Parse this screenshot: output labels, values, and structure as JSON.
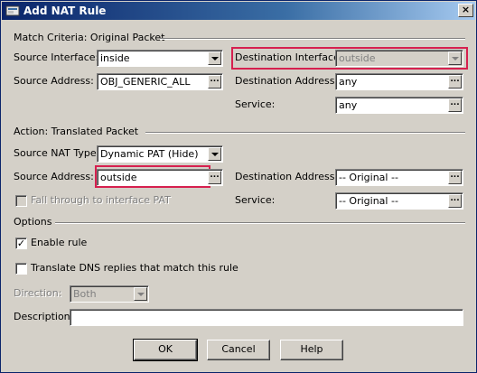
{
  "window": {
    "title": "Add NAT Rule",
    "close_label": "×"
  },
  "match_criteria": {
    "heading": "Match Criteria: Original Packet",
    "source_interface": {
      "label": "Source Interface:",
      "value": "inside"
    },
    "source_address": {
      "label": "Source Address:",
      "value": "OBJ_GENERIC_ALL"
    },
    "destination_interface": {
      "label": "Destination Interface:",
      "value": "outside",
      "disabled": true
    },
    "destination_address": {
      "label": "Destination Address:",
      "value": "any"
    },
    "service": {
      "label": "Service:",
      "value": "any"
    }
  },
  "action": {
    "heading": "Action: Translated Packet",
    "source_nat_type": {
      "label": "Source NAT Type:",
      "value": "Dynamic PAT (Hide)"
    },
    "source_address": {
      "label": "Source Address:",
      "value": "outside"
    },
    "destination_address": {
      "label": "Destination Address:",
      "value": "-- Original --"
    },
    "service": {
      "label": "Service:",
      "value": "-- Original --"
    },
    "fall_through": {
      "label": "Fall through to interface PAT",
      "checked": false,
      "disabled": true
    }
  },
  "options": {
    "heading": "Options",
    "enable_rule": {
      "label": "Enable rule",
      "checked": true
    },
    "translate_dns": {
      "label": "Translate DNS replies that match this rule",
      "checked": false
    },
    "direction": {
      "label": "Direction:",
      "value": "Both",
      "disabled": true
    },
    "description": {
      "label": "Description:",
      "value": ""
    }
  },
  "buttons": {
    "ok": "OK",
    "cancel": "Cancel",
    "help": "Help"
  },
  "browse_glyph": "...",
  "colors": {
    "dialog_bg": "#d4d0c8",
    "title_gradient_start": "#0a246a",
    "highlight": "#d6204f"
  }
}
